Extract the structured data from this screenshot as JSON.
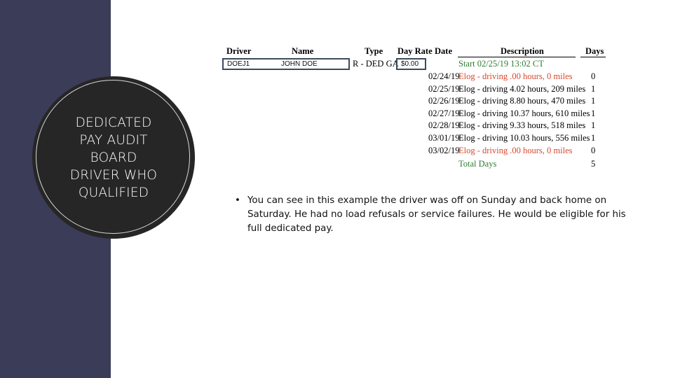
{
  "title": {
    "lines": [
      "DEDICATED",
      "PAY AUDIT",
      "BOARD",
      "DRIVER WHO",
      "QUALIFIED"
    ]
  },
  "table": {
    "headers": {
      "driver": "Driver",
      "name": "Name",
      "type": "Type",
      "day_rate": "Day Rate",
      "date": "Date",
      "description": "Description",
      "days": "Days"
    },
    "record": {
      "driver": "DOEJ1",
      "name": "JOHN DOE",
      "type": "R - DED GA",
      "day_rate": "$0.00",
      "start": "Start 02/25/19 13:02 CT"
    },
    "rows": [
      {
        "date": "02/24/19",
        "description": "Elog - driving .00 hours, 0 miles",
        "days": "0",
        "status": "red"
      },
      {
        "date": "02/25/19",
        "description": "Elog - driving 4.02 hours, 209 miles",
        "days": "1",
        "status": "normal"
      },
      {
        "date": "02/26/19",
        "description": "Elog - driving 8.80 hours, 470 miles",
        "days": "1",
        "status": "normal"
      },
      {
        "date": "02/27/19",
        "description": "Elog - driving 10.37 hours, 610 miles",
        "days": "1",
        "status": "normal"
      },
      {
        "date": "02/28/19",
        "description": "Elog - driving 9.33 hours, 518 miles",
        "days": "1",
        "status": "normal"
      },
      {
        "date": "03/01/19",
        "description": "Elog - driving 10.03 hours, 556 miles",
        "days": "1",
        "status": "normal"
      },
      {
        "date": "03/02/19",
        "description": "Elog - driving .00 hours, 0 miles",
        "days": "0",
        "status": "red"
      }
    ],
    "total": {
      "label": "Total Days",
      "value": "5"
    }
  },
  "bullet": {
    "marker": "•",
    "text": "You can see in this example the driver was off on Sunday and back home on Saturday. He had no load refusals or service failures. He would be eligible for his full dedicated pay."
  },
  "colors": {
    "sidebar": "#3b3c57",
    "circle": "#262626",
    "start_green": "#2e7d32",
    "zero_red": "#d9472b",
    "box_border": "#3d4a5c"
  }
}
